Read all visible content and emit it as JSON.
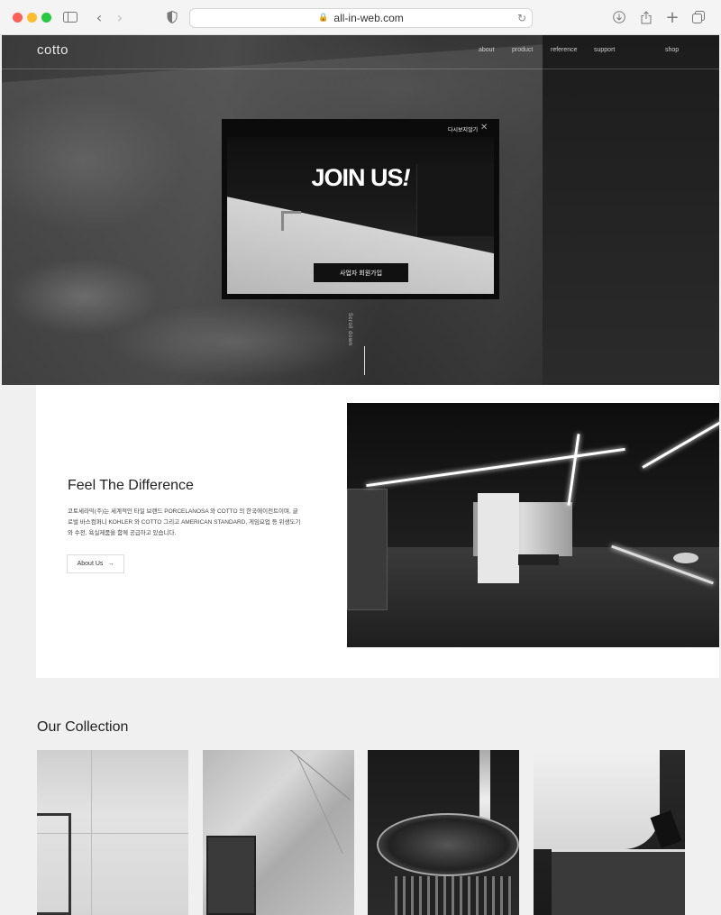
{
  "browser": {
    "url": "all-in-web.com"
  },
  "site": {
    "logo": "cotto",
    "nav": [
      "about",
      "product",
      "reference",
      "support",
      "shop"
    ],
    "scroll_label": "Scroll down"
  },
  "popup": {
    "close_label": "다시보지않기",
    "headline": "JOIN US",
    "headline_accent": "!",
    "cta": "사업자 회원가입"
  },
  "feel": {
    "title": "Feel The Difference",
    "description": "코토세라믹(주)는 세계적인 타일 브랜드 PORCELANOSA 와 COTTO 의 한국에이전트이며, 글로벌 바스컴퍼니 KOHLER 와 COTTO 그리고 AMERICAN STANDARD, 게임요업 등 위생도기와 수전, 욕실제품을 함께 공급하고 있습니다.",
    "button": "About Us",
    "button_arrow": "→"
  },
  "collection": {
    "title": "Our Collection"
  }
}
